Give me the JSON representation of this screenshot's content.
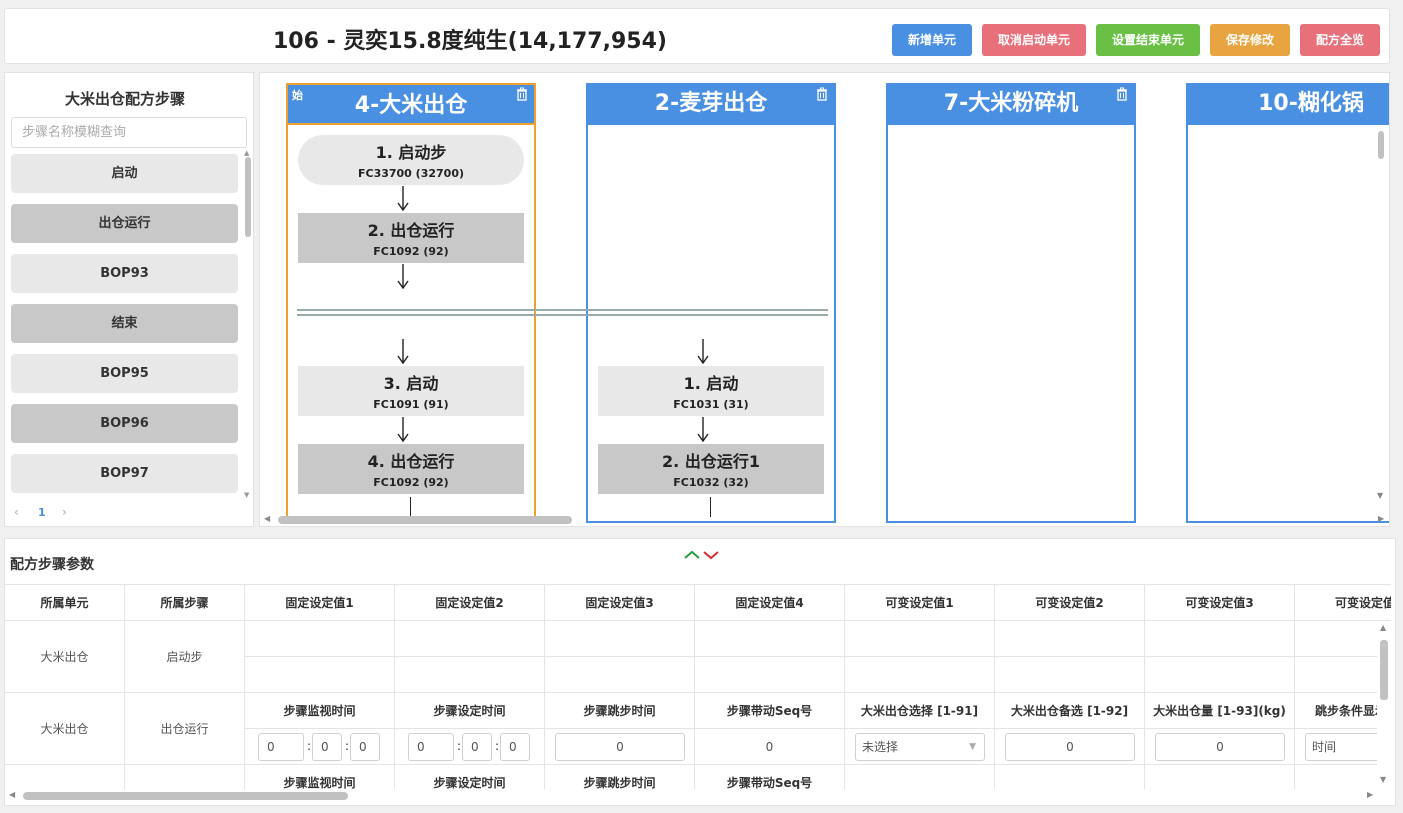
{
  "header": {
    "title": "106 - 灵奕15.8度纯生(14,177,954)",
    "buttons": [
      {
        "label": "新增单元",
        "color": "#4a90e2"
      },
      {
        "label": "取消启动单元",
        "color": "#e8707a"
      },
      {
        "label": "设置结束单元",
        "color": "#6ac045"
      },
      {
        "label": "保存修改",
        "color": "#e8a440"
      },
      {
        "label": "配方全览",
        "color": "#e8707a"
      }
    ]
  },
  "sidebar": {
    "title": "大米出仓配方步骤",
    "search_placeholder": "步骤名称模糊查询",
    "items": [
      "启动",
      "出仓运行",
      "BOP93",
      "结束",
      "BOP95",
      "BOP96",
      "BOP97"
    ],
    "pager": {
      "prev": "‹",
      "page": "1",
      "next": "›"
    }
  },
  "units": [
    {
      "name": "4-大米出仓",
      "start_tag": "始"
    },
    {
      "name": "2-麦芽出仓"
    },
    {
      "name": "7-大米粉碎机"
    },
    {
      "name": "10-糊化锅"
    }
  ],
  "steps_unit1": [
    {
      "label": "1. 启动步",
      "code": "FC33700 (32700)"
    },
    {
      "label": "2. 出仓运行",
      "code": "FC1092 (92)"
    },
    {
      "label": "3. 启动",
      "code": "FC1091 (91)"
    },
    {
      "label": "4. 出仓运行",
      "code": "FC1092 (92)"
    }
  ],
  "steps_unit2": [
    {
      "label": "1. 启动",
      "code": "FC1031 (31)"
    },
    {
      "label": "2. 出仓运行1",
      "code": "FC1032 (32)"
    }
  ],
  "params": {
    "title": "配方步骤参数",
    "headers": [
      "所属单元",
      "所属步骤",
      "固定设定值1",
      "固定设定值2",
      "固定设定值3",
      "固定设定值4",
      "可变设定值1",
      "可变设定值2",
      "可变设定值3",
      "可变设定值"
    ],
    "rows": [
      {
        "unit": "大米出仓",
        "step": "启动步"
      },
      {
        "unit": "大米出仓",
        "step": "出仓运行",
        "labels": [
          "步骤监视时间",
          "步骤设定时间",
          "步骤跳步时间",
          "步骤带动Seq号",
          "大米出仓选择 [1-91]",
          "大米出仓备选 [1-92]",
          "大米出仓量 [1-93](kg)",
          "跳步条件显示"
        ],
        "time_values": [
          "0",
          "0",
          "0"
        ],
        "jump_time": "0",
        "seq": "0",
        "select_value": "未选择",
        "backup": "0",
        "amount": "0",
        "cond": "时间"
      },
      {
        "labels": [
          "步骤监视时间",
          "步骤设定时间",
          "步骤跳步时间",
          "步骤带动Seq号"
        ]
      }
    ]
  }
}
